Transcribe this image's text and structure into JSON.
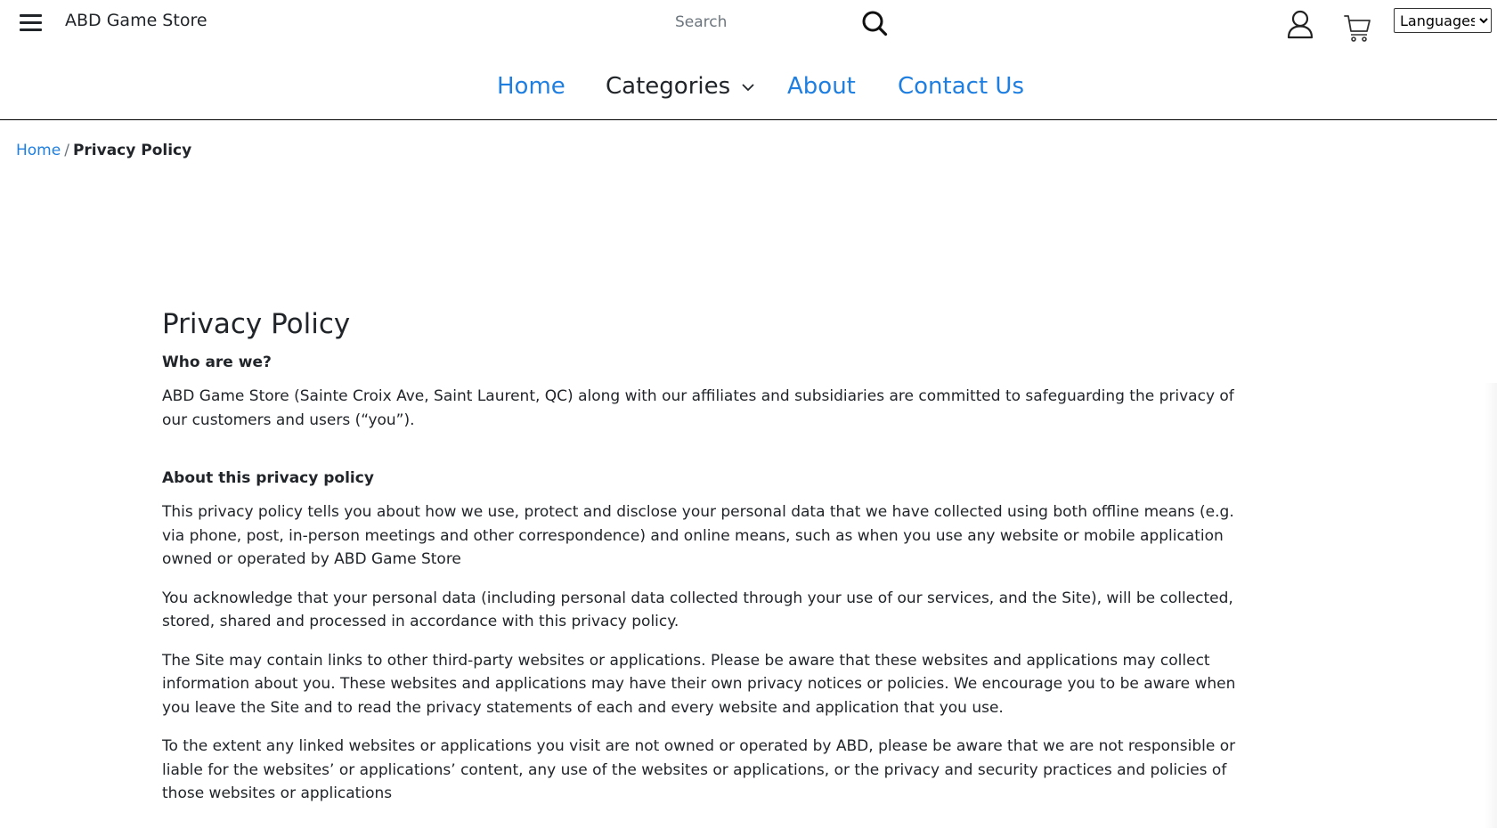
{
  "header": {
    "brand": "ABD Game Store",
    "search_placeholder": "Search",
    "language_select": {
      "selected": "Languages",
      "options": [
        "Languages"
      ]
    }
  },
  "nav": {
    "items": [
      {
        "label": "Home"
      },
      {
        "label": "Categories"
      },
      {
        "label": "About"
      },
      {
        "label": "Contact Us"
      }
    ]
  },
  "breadcrumb": {
    "home": "Home",
    "separator": "/",
    "current": "Privacy Policy"
  },
  "page": {
    "title": "Privacy Policy",
    "sections": [
      {
        "heading": "Who are we?",
        "paragraphs": [
          "ABD Game Store (Sainte Croix Ave, Saint Laurent, QC) along with our affiliates and subsidiaries are committed to safeguarding the privacy of our customers and users (“you”)."
        ]
      },
      {
        "heading": "About this privacy policy",
        "paragraphs": [
          "This privacy policy tells you about how we use, protect and disclose your personal data that we have collected using both offline means (e.g. via phone, post, in-person meetings and other correspondence) and online means, such as when you use any website or mobile application owned or operated by ABD Game Store",
          "You acknowledge that your personal data (including personal data collected through your use of our services, and the Site), will be collected, stored, shared and processed in accordance with this privacy policy.",
          "The Site may contain links to other third-party websites or applications. Please be aware that these websites and applications may collect information about you. These websites and applications may have their own privacy notices or policies. We encourage you to be aware when you leave the Site and to read the privacy statements of each and every website and application that you use.",
          "To the extent any linked websites or applications you visit are not owned or operated by ABD, please be aware that we are not responsible or liable for the websites’ or applications’ content, any use of the websites or applications, or the privacy and security practices and policies of those websites or applications"
        ]
      }
    ]
  },
  "colors": {
    "link": "#1f7fe0",
    "text": "#212529"
  },
  "icons": [
    "hamburger-menu-icon",
    "search-icon",
    "user-icon",
    "cart-icon",
    "chevron-down-icon"
  ]
}
